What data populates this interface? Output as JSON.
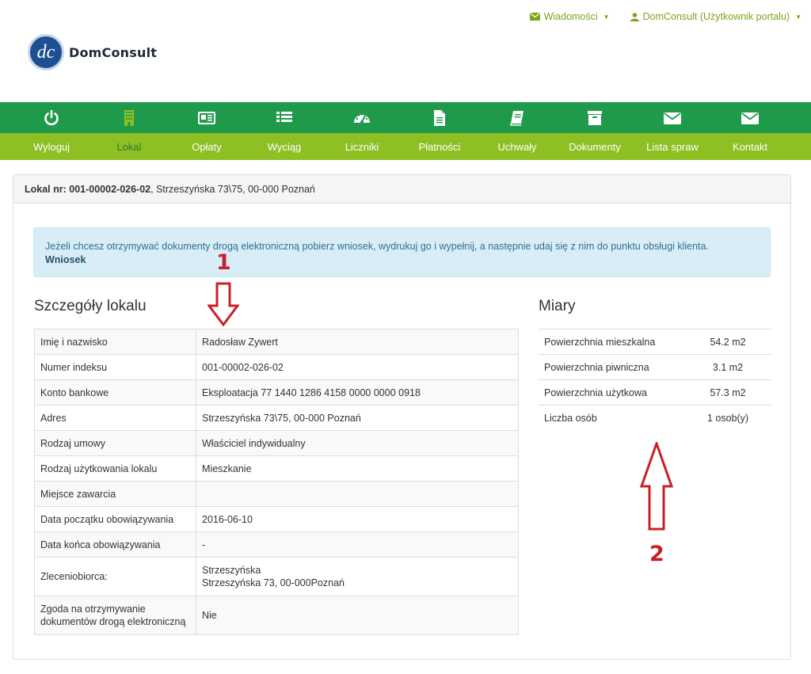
{
  "topbar": {
    "messages_label": "Wiadomości",
    "user_label": "DomConsult (Użytkownik portalu)"
  },
  "logo": {
    "text": "DomConsult"
  },
  "nav": [
    {
      "label": "Wyloguj",
      "icon": "power-icon"
    },
    {
      "label": "Lokal",
      "icon": "building-icon",
      "active": true
    },
    {
      "label": "Opłaty",
      "icon": "newspaper-icon"
    },
    {
      "label": "Wyciąg",
      "icon": "list-icon"
    },
    {
      "label": "Liczniki",
      "icon": "dashboard-icon"
    },
    {
      "label": "Płatności",
      "icon": "document-icon"
    },
    {
      "label": "Uchwały",
      "icon": "book-icon"
    },
    {
      "label": "Dokumenty",
      "icon": "archive-icon"
    },
    {
      "label": "Lista spraw",
      "icon": "envelope-icon"
    },
    {
      "label": "Kontakt",
      "icon": "envelope-icon"
    }
  ],
  "panel": {
    "heading_label": "Lokal nr: 001-00002-026-02",
    "heading_address": ", Strzeszyńska 73\\75, 00-000 Poznań"
  },
  "alert": {
    "text": "Jeżeli chcesz otrzymywać dokumenty drogą elektroniczną pobierz wniosek, wydrukuj go i wypełnij, a następnie udaj się z nim do punktu obsługi klienta.",
    "link": "Wniosek"
  },
  "details": {
    "title": "Szczegóły lokalu",
    "rows": [
      {
        "label": "Imię i nazwisko",
        "value": "Radosław Zywert"
      },
      {
        "label": "Numer indeksu",
        "value": "001-00002-026-02"
      },
      {
        "label": "Konto bankowe",
        "value": "Eksploatacja 77 1440 1286 4158 0000 0000 0918"
      },
      {
        "label": "Adres",
        "value": "Strzeszyńska 73\\75, 00-000 Poznań"
      },
      {
        "label": "Rodzaj umowy",
        "value": "Właściciel indywidualny"
      },
      {
        "label": "Rodzaj użytkowania lokalu",
        "value": "Mieszkanie"
      },
      {
        "label": "Miejsce zawarcia",
        "value": ""
      },
      {
        "label": "Data początku obowiązywania",
        "value": "2016-06-10"
      },
      {
        "label": "Data końca obowiązywania",
        "value": "-"
      },
      {
        "label": "Zleceniobiorca:",
        "value_line1": "Strzeszyńska",
        "value_line2": "Strzeszyńska 73, 00-000Poznań"
      },
      {
        "label_line1": "Zgoda na otrzymywanie",
        "label_line2": "dokumentów drogą elektroniczną",
        "value": "Nie"
      }
    ]
  },
  "measures": {
    "title": "Miary",
    "rows": [
      {
        "label": "Powierzchnia mieszkalna",
        "value": "54.2 m2"
      },
      {
        "label": "Powierzchnia piwniczna",
        "value": "3.1 m2"
      },
      {
        "label": "Powierzchnia użytkowa",
        "value": "57.3 m2"
      },
      {
        "label": "Liczba osób",
        "value": "1 osob(y)"
      }
    ]
  },
  "annotations": {
    "one": "1",
    "two": "2"
  },
  "colors": {
    "nav_dark": "#1f9a4b",
    "nav_light": "#8ebf23",
    "accent": "#7aa51c",
    "annotation": "#c8202a"
  }
}
